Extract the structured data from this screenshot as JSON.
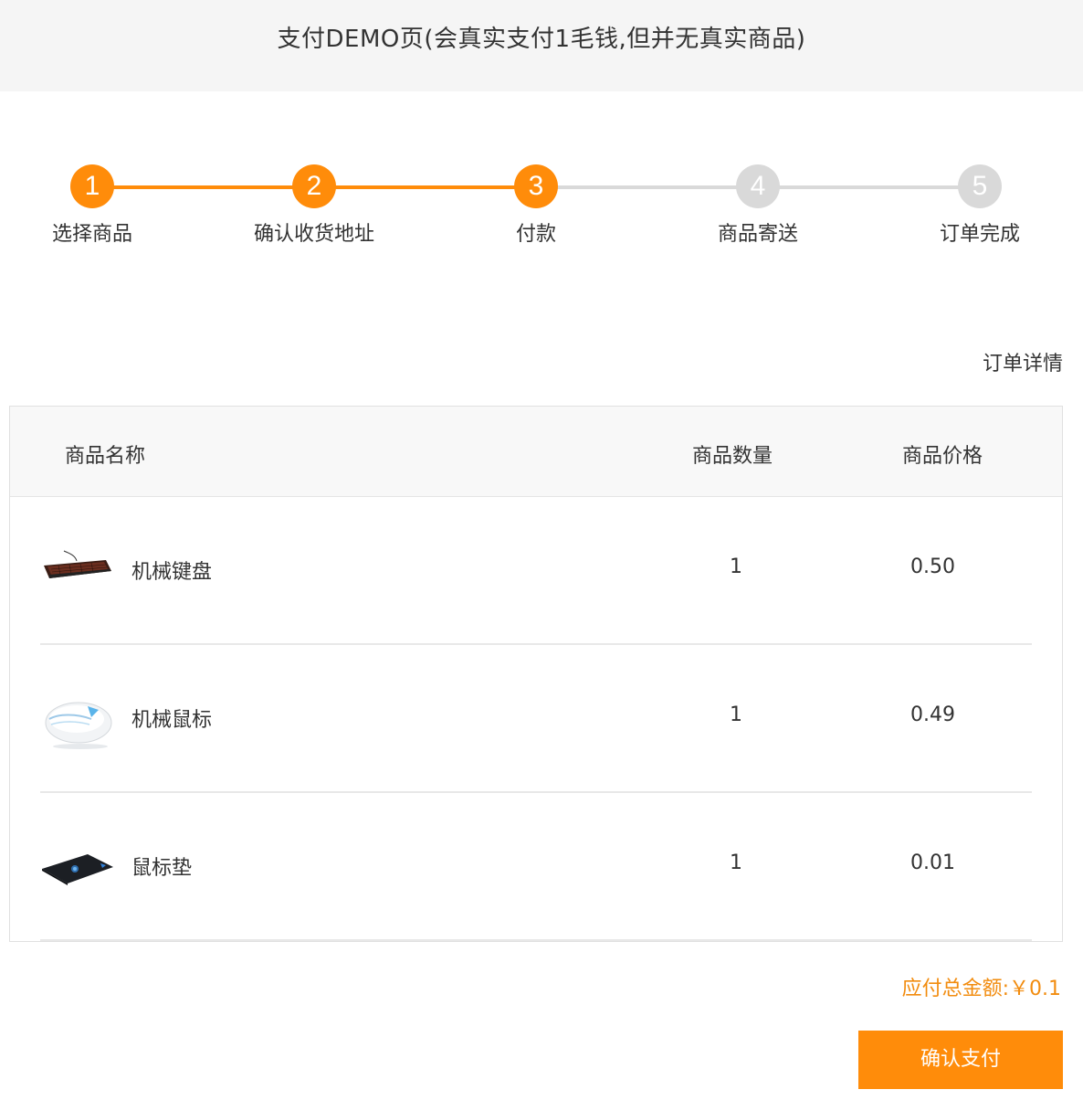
{
  "header": {
    "title": "支付DEMO页(会真实支付1毛钱,但并无真实商品)"
  },
  "colors": {
    "accent": "#ff8c0a",
    "inactive": "#d9d9d9",
    "header_bg": "#f5f5f5"
  },
  "steps": [
    {
      "number": "1",
      "label": "选择商品",
      "state": "done"
    },
    {
      "number": "2",
      "label": "确认收货地址",
      "state": "done"
    },
    {
      "number": "3",
      "label": "付款",
      "state": "current"
    },
    {
      "number": "4",
      "label": "商品寄送",
      "state": "pending"
    },
    {
      "number": "5",
      "label": "订单完成",
      "state": "pending"
    }
  ],
  "order": {
    "detail_label": "订单详情",
    "columns": {
      "name": "商品名称",
      "quantity": "商品数量",
      "price": "商品价格"
    },
    "items": [
      {
        "name": "机械键盘",
        "quantity": "1",
        "price": "0.50",
        "thumb": "keyboard-thumb"
      },
      {
        "name": "机械鼠标",
        "quantity": "1",
        "price": "0.49",
        "thumb": "mouse-thumb"
      },
      {
        "name": "鼠标垫",
        "quantity": "1",
        "price": "0.01",
        "thumb": "mousepad-thumb"
      }
    ]
  },
  "total": {
    "label": "应付总金额:",
    "amount": "￥0.1"
  },
  "actions": {
    "confirm_pay": "确认支付"
  }
}
